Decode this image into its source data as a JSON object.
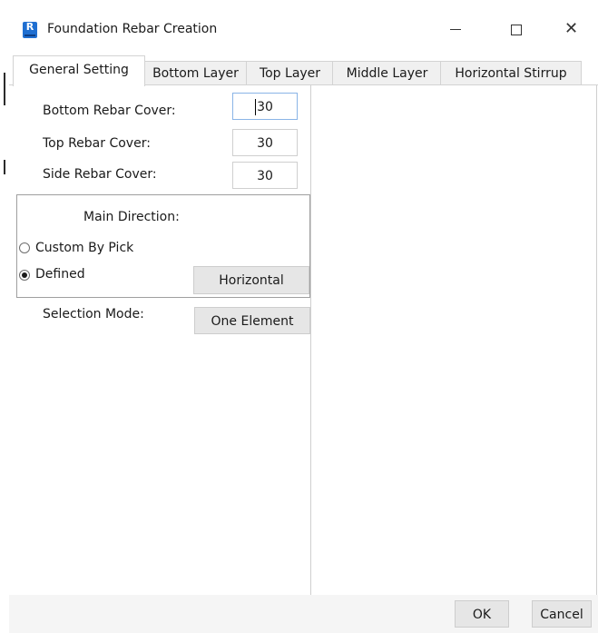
{
  "window": {
    "title": "Foundation Rebar Creation",
    "icon": "app-icon",
    "controls": {
      "minimize": "minimize-icon",
      "maximize": "maximize-icon",
      "close": "close-icon",
      "close_glyph": "✕"
    }
  },
  "tabs": [
    {
      "label": "General Setting",
      "active": true
    },
    {
      "label": "Bottom Layer",
      "active": false
    },
    {
      "label": "Top Layer",
      "active": false
    },
    {
      "label": "Middle Layer",
      "active": false
    },
    {
      "label": "Horizontal Stirrup",
      "active": false
    }
  ],
  "general": {
    "bottom_cover": {
      "label": "Bottom Rebar Cover:",
      "value": "30"
    },
    "top_cover": {
      "label": "Top Rebar Cover:",
      "value": "30"
    },
    "side_cover": {
      "label": "Side Rebar Cover:",
      "value": "30"
    },
    "main_direction": {
      "title": "Main Direction:",
      "options": [
        {
          "label": "Custom By Pick",
          "selected": false
        },
        {
          "label": "Defined",
          "selected": true
        }
      ],
      "direction_button": "Horizontal"
    },
    "selection_mode": {
      "label": "Selection Mode:",
      "value": "One Element"
    }
  },
  "footer": {
    "ok_label": "OK",
    "cancel_label": "Cancel"
  },
  "colors": {
    "accent": "#1f6fd1",
    "focus_border": "#8ab4e6"
  }
}
